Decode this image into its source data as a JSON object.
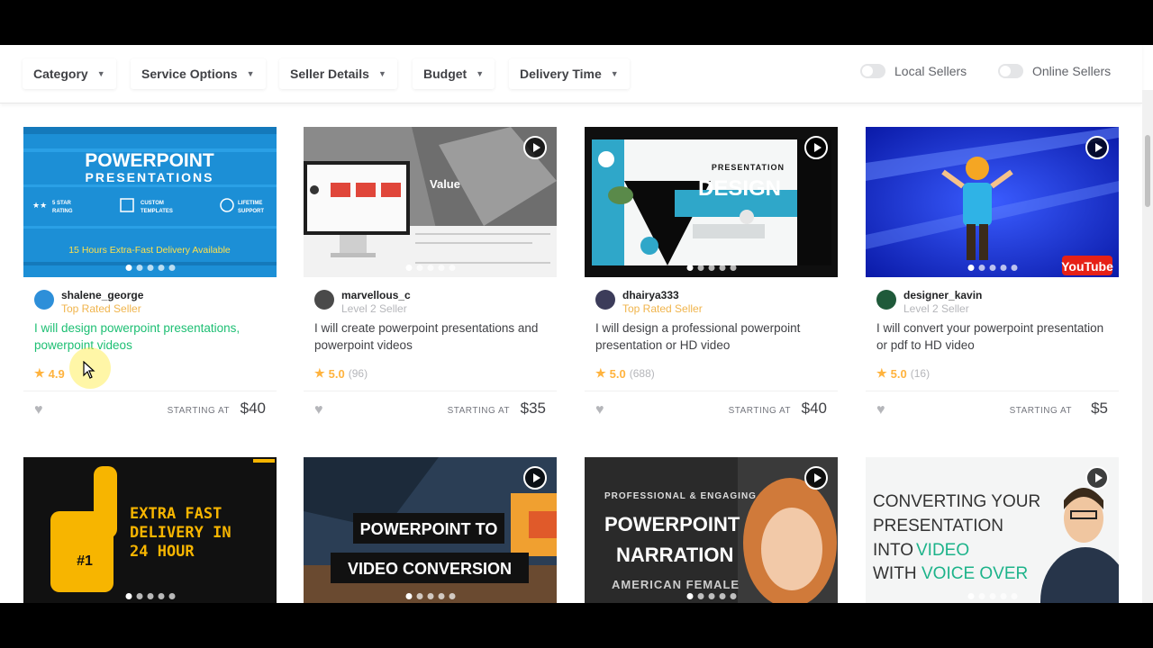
{
  "filters": {
    "category": "Category",
    "service_options": "Service Options",
    "seller_details": "Seller Details",
    "budget": "Budget",
    "delivery_time": "Delivery Time",
    "local_sellers": "Local Sellers",
    "online_sellers": "Online Sellers"
  },
  "gigs": [
    {
      "seller": "shalene_george",
      "level": "Top Rated Seller",
      "title": "I will design powerpoint presentations, powerpoint videos",
      "rating": "4.9",
      "reviews": "",
      "starting_label": "STARTING AT",
      "price": "$40",
      "thumb": {
        "title1": "POWERPOINT",
        "title2": "PRESENTATIONS",
        "feat1a": "5 STAR",
        "feat1b": "RATING",
        "feat2a": "CUSTOM",
        "feat2b": "TEMPLATES",
        "feat3a": "LIFETIME",
        "feat3b": "SUPPORT",
        "delivery": "15 Hours Extra-Fast Delivery Available"
      }
    },
    {
      "seller": "marvellous_c",
      "level": "Level 2 Seller",
      "title": "I will create powerpoint presentations and powerpoint videos",
      "rating": "5.0",
      "reviews": "(96)",
      "starting_label": "STARTING AT",
      "price": "$35",
      "thumb": {
        "value": "Value"
      }
    },
    {
      "seller": "dhairya333",
      "level": "Top Rated Seller",
      "title": "I will design a professional powerpoint presentation or HD video",
      "rating": "5.0",
      "reviews": "(688)",
      "starting_label": "STARTING AT",
      "price": "$40",
      "thumb": {
        "small": "PRESENTATION",
        "big": "DESIGN"
      }
    },
    {
      "seller": "designer_kavin",
      "level": "Level 2 Seller",
      "title": "I will convert your powerpoint presentation or pdf to HD video",
      "rating": "5.0",
      "reviews": "(16)",
      "starting_label": "STARTING AT",
      "price": "$5",
      "thumb": {
        "logo": "YouTube"
      }
    }
  ],
  "second_row": [
    {
      "line1": "EXTRA FAST",
      "line2": "DELIVERY IN",
      "line3": "24 HOUR"
    },
    {
      "line1": "POWERPOINT TO",
      "line2": "VIDEO CONVERSION"
    },
    {
      "kicker": "PROFESSIONAL & ENGAGING",
      "line1": "POWERPOINT",
      "line2": "NARRATION",
      "sub": "AMERICAN FEMALE"
    },
    {
      "line1": "CONVERTING YOUR",
      "line2": "PRESENTATION",
      "line3a": "INTO",
      "line3b": "VIDEO",
      "line4a": "WITH",
      "line4b": "VOICE OVER"
    }
  ],
  "colors": {
    "accent_green": "#1dbf73",
    "star": "#ffb33e",
    "top_rated": "#f0b44c"
  }
}
